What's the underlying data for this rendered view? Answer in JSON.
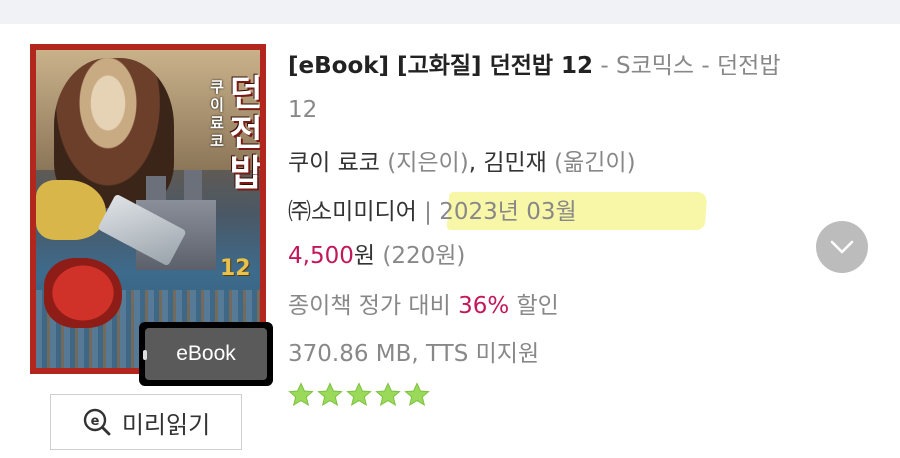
{
  "book": {
    "title_main": "[eBook] [고화질] 던전밥 12",
    "title_sub": " - S코믹스 - 던전밥 12",
    "authors": [
      {
        "name": "쿠이 료코",
        "role": "(지은이)"
      },
      {
        "name": "김민재",
        "role": "(옮긴이)"
      }
    ],
    "author_separator": ", ",
    "publisher": "㈜소미미디어",
    "date_separator": " | ",
    "pub_date": "2023년 03월",
    "price": "4,500",
    "price_unit": "원",
    "point": " (220원)",
    "discount_prefix": "종이책 정가 대비 ",
    "discount_rate": "36%",
    "discount_suffix": " 할인",
    "file_info": "370.86 MB, TTS 미지원",
    "rating_stars": 5
  },
  "cover": {
    "author_text": "쿠이료코",
    "title_text": "던전밥",
    "volume_text": "12",
    "ebook_tag": "eBook"
  },
  "actions": {
    "preview_label": "미리읽기"
  },
  "colors": {
    "accent": "#c2185b",
    "star": "#9bd95a",
    "highlight": "#f6f48a",
    "cover_frame": "#b3261e"
  },
  "icons": {
    "preview": "e-search-icon",
    "expand": "chevron-down-icon",
    "star": "star-icon"
  }
}
